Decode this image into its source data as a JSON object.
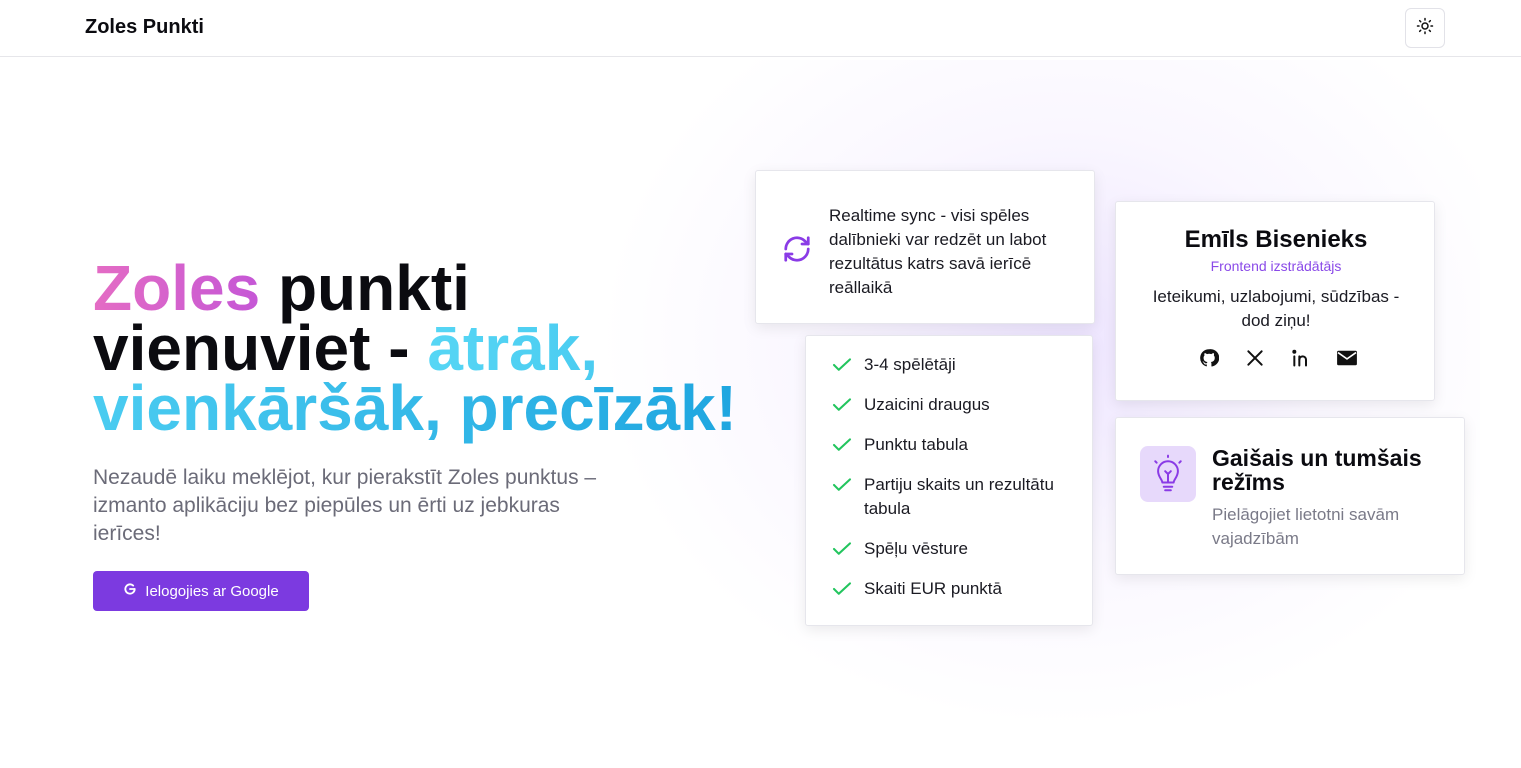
{
  "header": {
    "brand": "Zoles Punkti",
    "theme_toggle_icon": "sun-icon"
  },
  "hero": {
    "title_part1": "Zoles",
    "title_part2": " punkti vienuviet -",
    "title_part3": "ātrāk, vienkāršāk, precīzāk!",
    "subtitle": "Nezaudē laiku meklējot, kur pierakstīt Zoles punktus – izmanto aplikāciju bez piepūles un ērti uz jebkuras ierīces!",
    "google_button": "Ielogojies ar Google",
    "google_icon": "google-icon"
  },
  "sync_card": {
    "icon": "refresh-icon",
    "text": "Realtime sync - visi spēles dalībnieki var redzēt un labot rezultātus katrs savā ierīcē reāllaikā"
  },
  "features": [
    "3-4 spēlētāji",
    "Uzaicini draugus",
    "Punktu tabula",
    "Partiju skaits un rezultātu tabula",
    "Spēļu vēsture",
    "Skaiti EUR punktā"
  ],
  "profile": {
    "name": "Emīls Bisenieks",
    "role": "Frontend izstrādātājs",
    "note": "Ieteikumi, uzlabojumi, sūdzības - dod ziņu!",
    "socials": [
      "github-icon",
      "x-icon",
      "linkedin-icon",
      "mail-icon"
    ]
  },
  "theme_card": {
    "icon": "lightbulb-icon",
    "title": "Gaišais un tumšais režīms",
    "subtitle": "Pielāgojiet lietotni savām vajadzībām"
  },
  "colors": {
    "accent": "#7c3ae0",
    "pink": "#e46cc4",
    "blue": "#1fa6e0",
    "check": "#22c55e"
  }
}
